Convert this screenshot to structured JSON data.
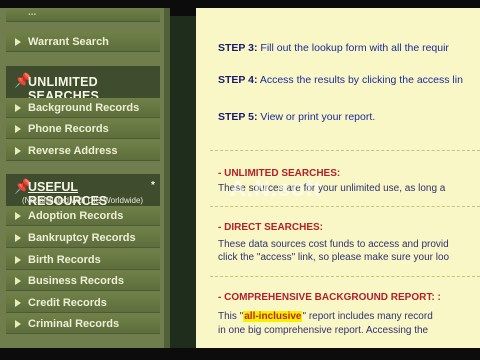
{
  "sidebar": {
    "clipped_item": "...",
    "warrant": "Warrant Search",
    "unlimited_title": "UNLIMITED SEARCHES",
    "unlimited_items": [
      "Background Records",
      "Phone Records",
      "Reverse Address"
    ],
    "useful_title": "USEFUL RESOURCES",
    "useful_star": "*",
    "useful_note": "(Not affiliated with CIS Worldwide)",
    "useful_items": [
      "Adoption Records",
      "Bankruptcy Records",
      "Birth Records",
      "Business Records",
      "Credit Records",
      "Criminal Records"
    ]
  },
  "main": {
    "step3_label": "STEP 3:",
    "step3_text": "Fill out the lookup form with all the requir",
    "step4_label": "STEP 4:",
    "step4_text": "Access the results by clicking the access lin",
    "step5_label": "STEP 5:",
    "step5_text": "View or print your report.",
    "unlimited_head": "- UNLIMITED SEARCHES:",
    "unlimited_body": "These sources are for your unlimited use, as long a",
    "direct_head": "- DIRECT SEARCHES:",
    "direct_body1": "These data sources cost funds to access and provid",
    "direct_body2": "click the \"access\" link, so please make sure your loo",
    "comp_head": "- COMPREHENSIVE BACKGROUND REPORT: :",
    "comp_pre": "This \"",
    "comp_hl": "all-inclusive",
    "comp_post": "\" report includes many record",
    "comp_body2": "in one big comprehensive report. Accessing the ",
    "watermark": "A.N.soft"
  }
}
